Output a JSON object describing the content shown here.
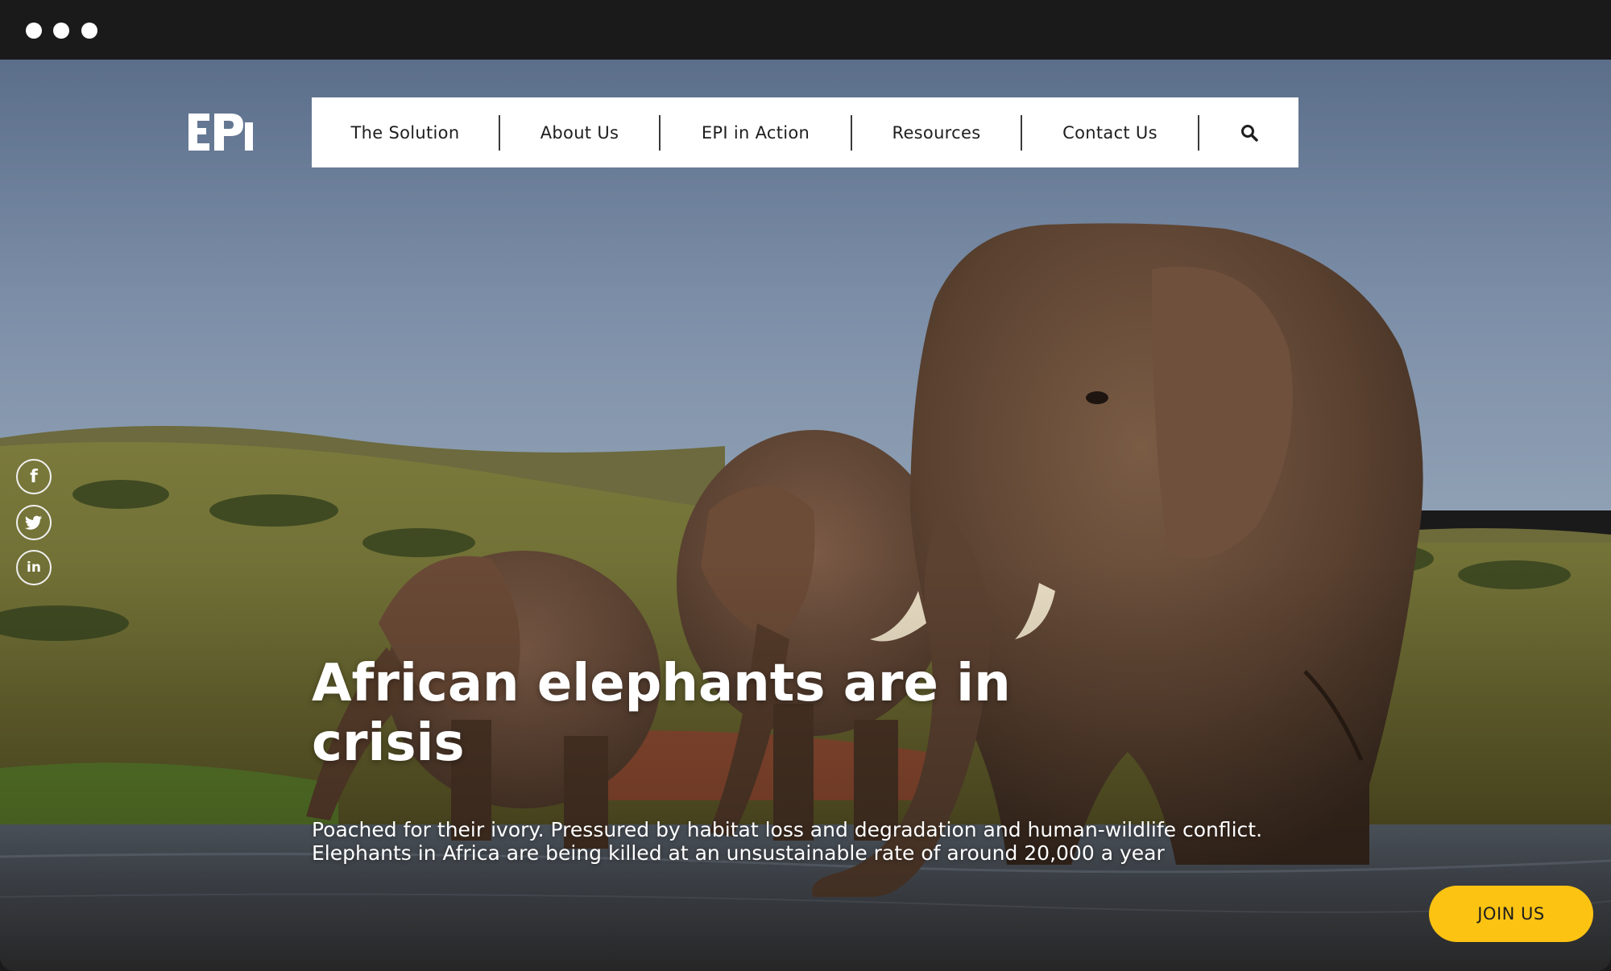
{
  "window": {
    "controls": [
      "close",
      "minimize",
      "maximize"
    ]
  },
  "logo": {
    "icon": "epi-logo-icon"
  },
  "nav": {
    "items": [
      {
        "label": "The Solution"
      },
      {
        "label": "About Us"
      },
      {
        "label": "EPI in Action"
      },
      {
        "label": "Resources"
      },
      {
        "label": "Contact Us"
      }
    ],
    "search_icon": "search-icon"
  },
  "social": [
    {
      "icon": "facebook-icon",
      "glyph": "f"
    },
    {
      "icon": "twitter-icon",
      "glyph": ""
    },
    {
      "icon": "linkedin-icon",
      "glyph": "in"
    }
  ],
  "hero": {
    "headline": "African elephants are in crisis",
    "subtext": "Poached for their ivory. Pressured by habitat loss and degradation and human-wildlife conflict. Elephants in Africa are being killed at an unsustainable rate of around 20,000 a year",
    "image": "elephants-drinking-at-waterhole"
  },
  "cta": {
    "label": "JOIN US"
  },
  "colors": {
    "accent": "#fcc312",
    "chrome": "#1b1a1a",
    "nav_bg": "#ffffff"
  }
}
